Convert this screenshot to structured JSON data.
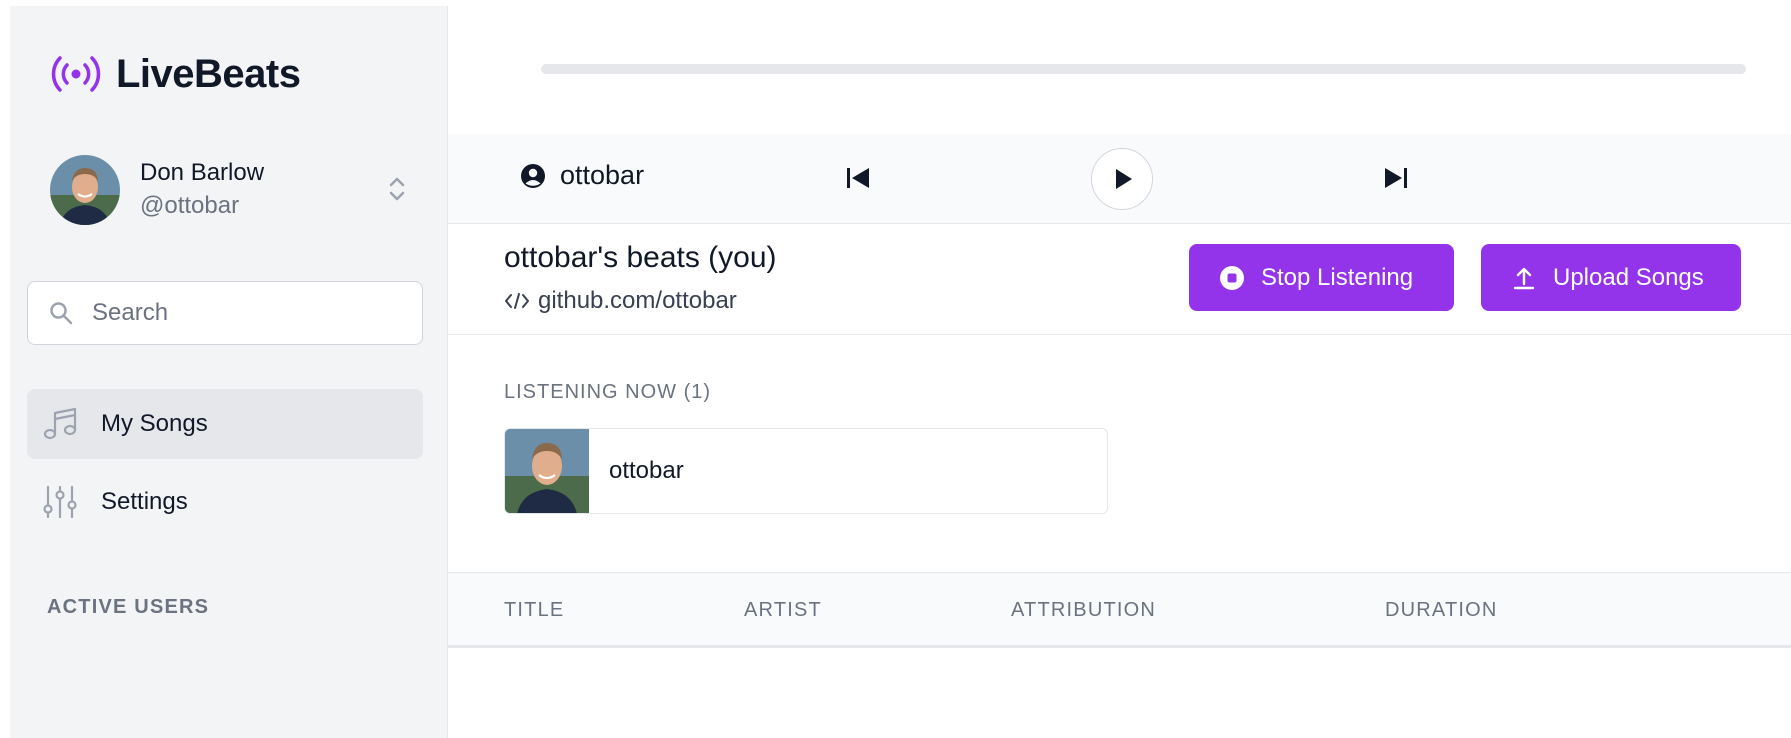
{
  "app": {
    "name": "LiveBeats"
  },
  "user": {
    "name": "Don Barlow",
    "handle": "@ottobar"
  },
  "search": {
    "placeholder": "Search"
  },
  "nav": [
    {
      "label": "My Songs",
      "icon": "music-note-icon",
      "active": true
    },
    {
      "label": "Settings",
      "icon": "sliders-icon",
      "active": false
    }
  ],
  "sidebar": {
    "active_users_title": "ACTIVE USERS"
  },
  "player": {
    "current_user": "ottobar"
  },
  "profile": {
    "title": "ottobar's beats (you)",
    "link": "github.com/ottobar"
  },
  "buttons": {
    "stop_listening": "Stop Listening",
    "upload_songs": "Upload Songs"
  },
  "listening": {
    "title": "LISTENING NOW (1)",
    "listeners": [
      {
        "name": "ottobar"
      }
    ]
  },
  "table": {
    "columns": [
      "TITLE",
      "ARTIST",
      "ATTRIBUTION",
      "DURATION"
    ],
    "rows": []
  },
  "colors": {
    "accent": "#9333ea",
    "sidebar_bg": "#f3f4f6",
    "muted_text": "#6b7280"
  }
}
